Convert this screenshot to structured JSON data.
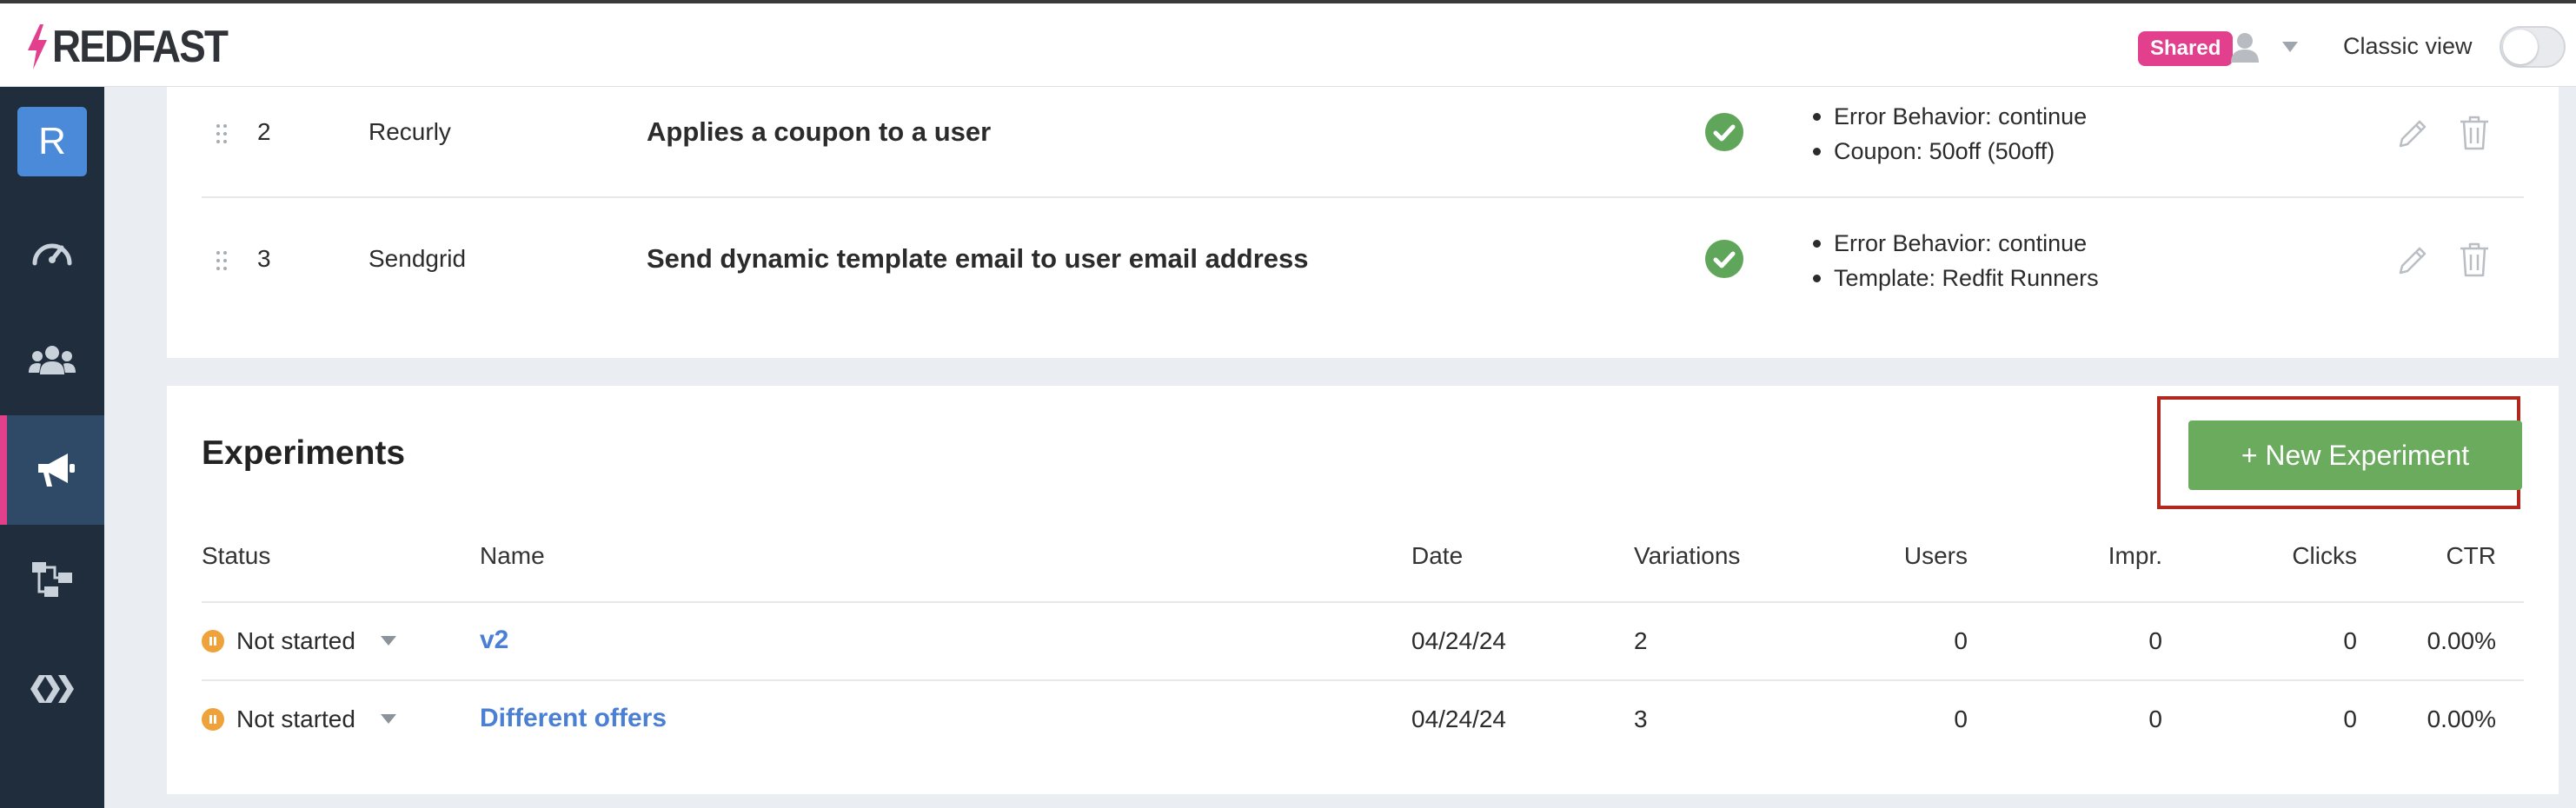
{
  "brand": {
    "name": "REDFAST"
  },
  "header": {
    "shared_badge": "Shared",
    "classic_view_label": "Classic view",
    "colors": {
      "badge": "#e23f8c",
      "accent": "#6aab5e"
    }
  },
  "sidebar": {
    "avatar_letter": "R",
    "items": [
      {
        "icon": "dashboard-gauge-icon"
      },
      {
        "icon": "users-icon"
      },
      {
        "icon": "megaphone-icon",
        "active": true
      },
      {
        "icon": "flow-diagram-icon"
      },
      {
        "icon": "chevrons-icon"
      }
    ]
  },
  "actions": {
    "rows": [
      {
        "index": "2",
        "integration": "Recurly",
        "action": "Applies a coupon to a user",
        "details": [
          "Error Behavior: continue",
          "Coupon: 50off (50off)"
        ]
      },
      {
        "index": "3",
        "integration": "Sendgrid",
        "action": "Send dynamic template email to user email address",
        "details": [
          "Error Behavior: continue",
          "Template: Redfit Runners"
        ]
      }
    ]
  },
  "experiments": {
    "title": "Experiments",
    "new_button": "+ New Experiment",
    "columns": {
      "status": "Status",
      "name": "Name",
      "date": "Date",
      "variations": "Variations",
      "users": "Users",
      "impr": "Impr.",
      "clicks": "Clicks",
      "ctr": "CTR"
    },
    "rows": [
      {
        "status": "Not started",
        "name": "v2",
        "date": "04/24/24",
        "variations": "2",
        "users": "0",
        "impr": "0",
        "clicks": "0",
        "ctr": "0.00%"
      },
      {
        "status": "Not started",
        "name": "Different offers",
        "date": "04/24/24",
        "variations": "3",
        "users": "0",
        "impr": "0",
        "clicks": "0",
        "ctr": "0.00%"
      }
    ]
  }
}
